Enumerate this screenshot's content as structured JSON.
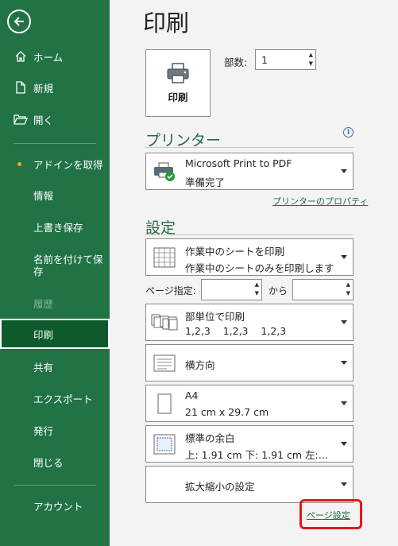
{
  "sidebar": {
    "items": [
      {
        "label": "ホーム"
      },
      {
        "label": "新規"
      },
      {
        "label": "開く"
      },
      {
        "label": "アドインを取得"
      },
      {
        "label": "情報"
      },
      {
        "label": "上書き保存"
      },
      {
        "label": "名前を付けて保存"
      },
      {
        "label": "履歴"
      },
      {
        "label": "印刷"
      },
      {
        "label": "共有"
      },
      {
        "label": "エクスポート"
      },
      {
        "label": "発行"
      },
      {
        "label": "閉じる"
      },
      {
        "label": "アカウント"
      }
    ]
  },
  "main": {
    "title": "印刷",
    "print_button_label": "印刷",
    "copies_label": "部数:",
    "copies_value": "1",
    "printer_heading": "プリンター",
    "printer": {
      "name": "Microsoft Print to PDF",
      "status": "準備完了"
    },
    "printer_properties_link": "プリンターのプロパティ",
    "settings_heading": "設定",
    "scope": {
      "title": "作業中のシートを印刷",
      "desc": "作業中のシートのみを印刷します"
    },
    "pages_label": "ページ指定:",
    "pages_from": "",
    "to_label": "から",
    "pages_to": "",
    "collate": {
      "title": "部単位で印刷",
      "desc": "1,2,3    1,2,3    1,2,3"
    },
    "orientation": {
      "title": "横方向"
    },
    "paper": {
      "title": "A4",
      "desc": "21 cm x 29.7 cm"
    },
    "margins": {
      "title": "標準の余白",
      "desc": "上: 1.91 cm 下: 1.91 cm 左:…"
    },
    "scaling": {
      "title": "拡大縮小の設定"
    },
    "page_setup_link": "ページ設定"
  },
  "colors": {
    "sidebar_bg": "#217346",
    "selected_bg": "#0e5a2c",
    "accent": "#1e6c3f",
    "highlight": "#e0191c"
  }
}
